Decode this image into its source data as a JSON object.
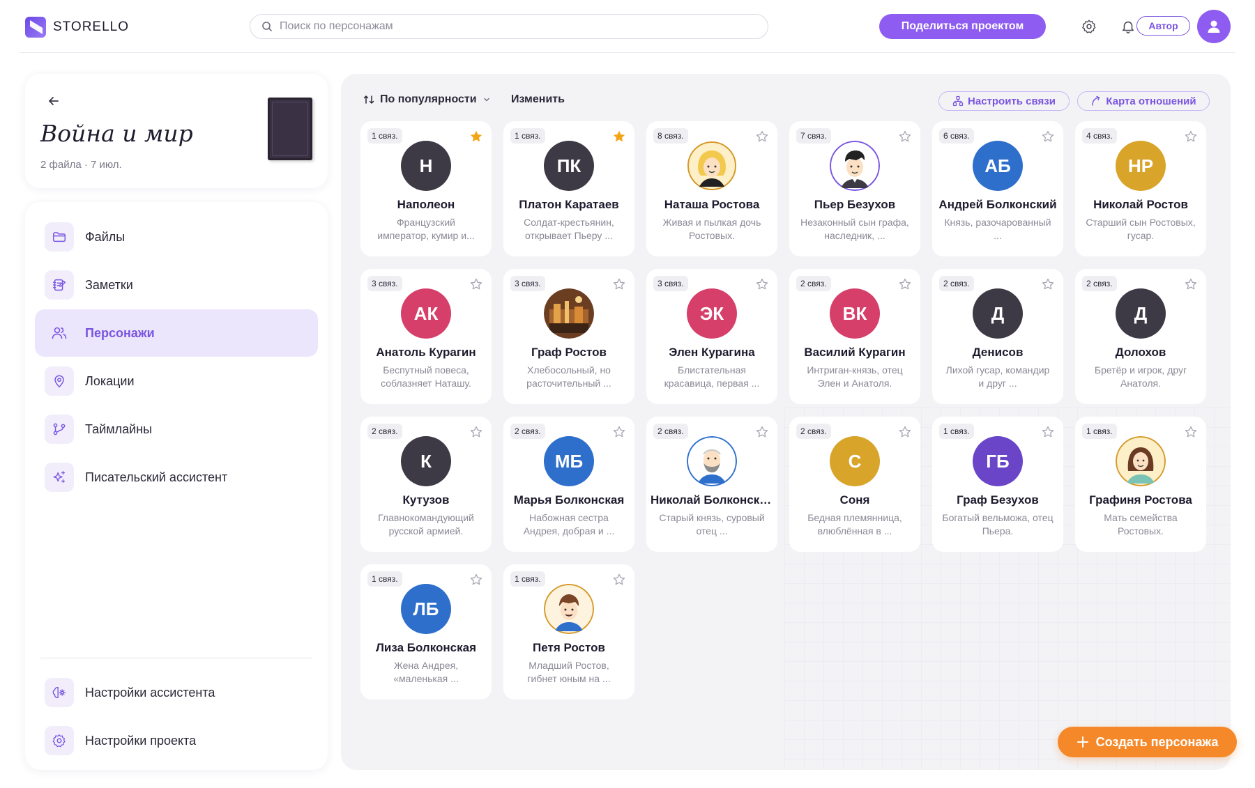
{
  "app": {
    "name": "STORELLO"
  },
  "search": {
    "placeholder": "Поиск по персонажам"
  },
  "header": {
    "share_label": "Поделиться проектом",
    "role_label": "Автор"
  },
  "project": {
    "title": "Война и мир",
    "meta": "2 файла · 7 июл."
  },
  "nav": {
    "items": [
      {
        "label": "Файлы",
        "icon": "folder-icon"
      },
      {
        "label": "Заметки",
        "icon": "notes-icon"
      },
      {
        "label": "Персонажи",
        "icon": "users-icon"
      },
      {
        "label": "Локации",
        "icon": "location-pin-icon"
      },
      {
        "label": "Таймлайны",
        "icon": "timeline-branch-icon"
      },
      {
        "label": "Писательский ассистент",
        "icon": "sparkles-icon"
      }
    ],
    "bottom": [
      {
        "label": "Настройки ассистента",
        "icon": "assistant-settings-icon"
      },
      {
        "label": "Настройки проекта",
        "icon": "gear-icon"
      }
    ]
  },
  "toolbar": {
    "sort_label": "По популярности",
    "edit_label": "Изменить",
    "configure_label": "Настроить связи",
    "map_label": "Карта отношений"
  },
  "create_label": "Создать персонажа",
  "colors": {
    "accent": "#8e5cf0",
    "orange": "#f5892a",
    "star": "#f2a516"
  },
  "characters": [
    {
      "badge": "1 связ.",
      "initials": "Н",
      "name": "Наполеон",
      "desc": "Французский император, кумир и...",
      "color": "#3d3a45",
      "starred": true,
      "portrait": false
    },
    {
      "badge": "1 связ.",
      "initials": "ПК",
      "name": "Платон Каратаев",
      "desc": "Солдат-крестьянин, открывает Пьеру ...",
      "color": "#3d3a45",
      "starred": true,
      "portrait": false
    },
    {
      "badge": "8 связ.",
      "initials": "",
      "name": "Наташа Ростова",
      "desc": "Живая и пылкая дочь Ростовых.",
      "color": "#f6d76a",
      "starred": false,
      "portrait": true
    },
    {
      "badge": "7 связ.",
      "initials": "",
      "name": "Пьер Безухов",
      "desc": "Незаконный сын графа, наследник, ...",
      "color": "#ffffff",
      "starred": false,
      "portrait": true
    },
    {
      "badge": "6 связ.",
      "initials": "АБ",
      "name": "Андрей Болконский",
      "desc": "Князь, разочарованный ...",
      "color": "#2e6fcc",
      "starred": false,
      "portrait": false
    },
    {
      "badge": "4 связ.",
      "initials": "НР",
      "name": "Николай Ростов",
      "desc": "Старший сын Ростовых, гусар.",
      "color": "#d8a42a",
      "starred": false,
      "portrait": false
    },
    {
      "badge": "3 связ.",
      "initials": "АК",
      "name": "Анатоль Курагин",
      "desc": "Беспутный повеса, соблазняет Наташу.",
      "color": "#d63f6a",
      "starred": false,
      "portrait": false
    },
    {
      "badge": "3 связ.",
      "initials": "",
      "name": "Граф Ростов",
      "desc": "Хлебосольный, но расточительный ...",
      "color": "#7a4a2c",
      "starred": false,
      "portrait": true
    },
    {
      "badge": "3 связ.",
      "initials": "ЭК",
      "name": "Элен Курагина",
      "desc": "Блистательная красавица, первая ...",
      "color": "#d63f6a",
      "starred": false,
      "portrait": false
    },
    {
      "badge": "2 связ.",
      "initials": "ВК",
      "name": "Василий Курагин",
      "desc": "Интриган-князь, отец Элен и Анатоля.",
      "color": "#d63f6a",
      "starred": false,
      "portrait": false
    },
    {
      "badge": "2 связ.",
      "initials": "Д",
      "name": "Денисов",
      "desc": "Лихой гусар, командир и друг ...",
      "color": "#3d3a45",
      "starred": false,
      "portrait": false
    },
    {
      "badge": "2 связ.",
      "initials": "Д",
      "name": "Долохов",
      "desc": "Бретёр и игрок, друг Анатоля.",
      "color": "#3d3a45",
      "starred": false,
      "portrait": false
    },
    {
      "badge": "2 связ.",
      "initials": "К",
      "name": "Кутузов",
      "desc": "Главнокомандующий русской армией.",
      "color": "#3d3a45",
      "starred": false,
      "portrait": false
    },
    {
      "badge": "2 связ.",
      "initials": "МБ",
      "name": "Марья Болконская",
      "desc": "Набожная сестра Андрея, добрая и ...",
      "color": "#2e6fcc",
      "starred": false,
      "portrait": false
    },
    {
      "badge": "2 связ.",
      "initials": "",
      "name": "Николай Болконский",
      "desc": "Старый князь, суровый отец ...",
      "color": "#ffffff",
      "starred": false,
      "portrait": true
    },
    {
      "badge": "2 связ.",
      "initials": "С",
      "name": "Соня",
      "desc": "Бедная племянница, влюблённая в ...",
      "color": "#d8a42a",
      "starred": false,
      "portrait": false
    },
    {
      "badge": "1 связ.",
      "initials": "ГБ",
      "name": "Граф Безухов",
      "desc": "Богатый вельможа, отец Пьера.",
      "color": "#6a45c8",
      "starred": false,
      "portrait": false
    },
    {
      "badge": "1 связ.",
      "initials": "",
      "name": "Графиня Ростова",
      "desc": "Мать семейства Ростовых.",
      "color": "#f3d67a",
      "starred": false,
      "portrait": true
    },
    {
      "badge": "1 связ.",
      "initials": "ЛБ",
      "name": "Лиза Болконская",
      "desc": "Жена Андрея, «маленькая ...",
      "color": "#2e6fcc",
      "starred": false,
      "portrait": false
    },
    {
      "badge": "1 связ.",
      "initials": "",
      "name": "Петя Ростов",
      "desc": "Младший Ростов, гибнет юным на ...",
      "color": "#f3e0b8",
      "starred": false,
      "portrait": true
    }
  ]
}
